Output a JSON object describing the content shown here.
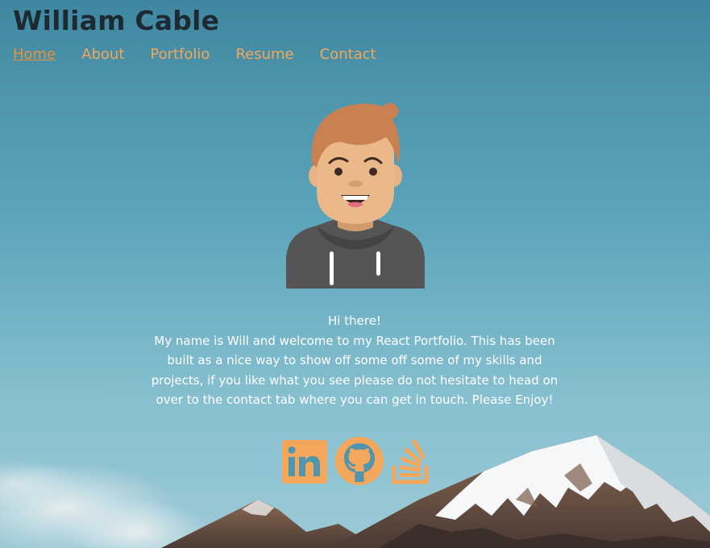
{
  "site": {
    "title": "William Cable"
  },
  "nav": {
    "items": [
      {
        "label": "Home",
        "active": true
      },
      {
        "label": "About",
        "active": false
      },
      {
        "label": "Portfolio",
        "active": false
      },
      {
        "label": "Resume",
        "active": false
      },
      {
        "label": "Contact",
        "active": false
      }
    ]
  },
  "intro": {
    "greeting": "Hi there!",
    "body": "My name is Will and welcome to my React Portfolio. This has been built as a nice way to show off some off some of my skills and projects, if you like what you see please do not hesitate to head on over to the contact tab where you can get in touch. Please Enjoy!"
  },
  "socials": [
    {
      "icon": "linkedin-icon"
    },
    {
      "icon": "github-icon"
    },
    {
      "icon": "stackoverflow-icon"
    }
  ],
  "colors": {
    "accent": "#f4a75a",
    "title": "#1e2a33",
    "text": "#ffffff",
    "sky": "#5aa3ba"
  }
}
